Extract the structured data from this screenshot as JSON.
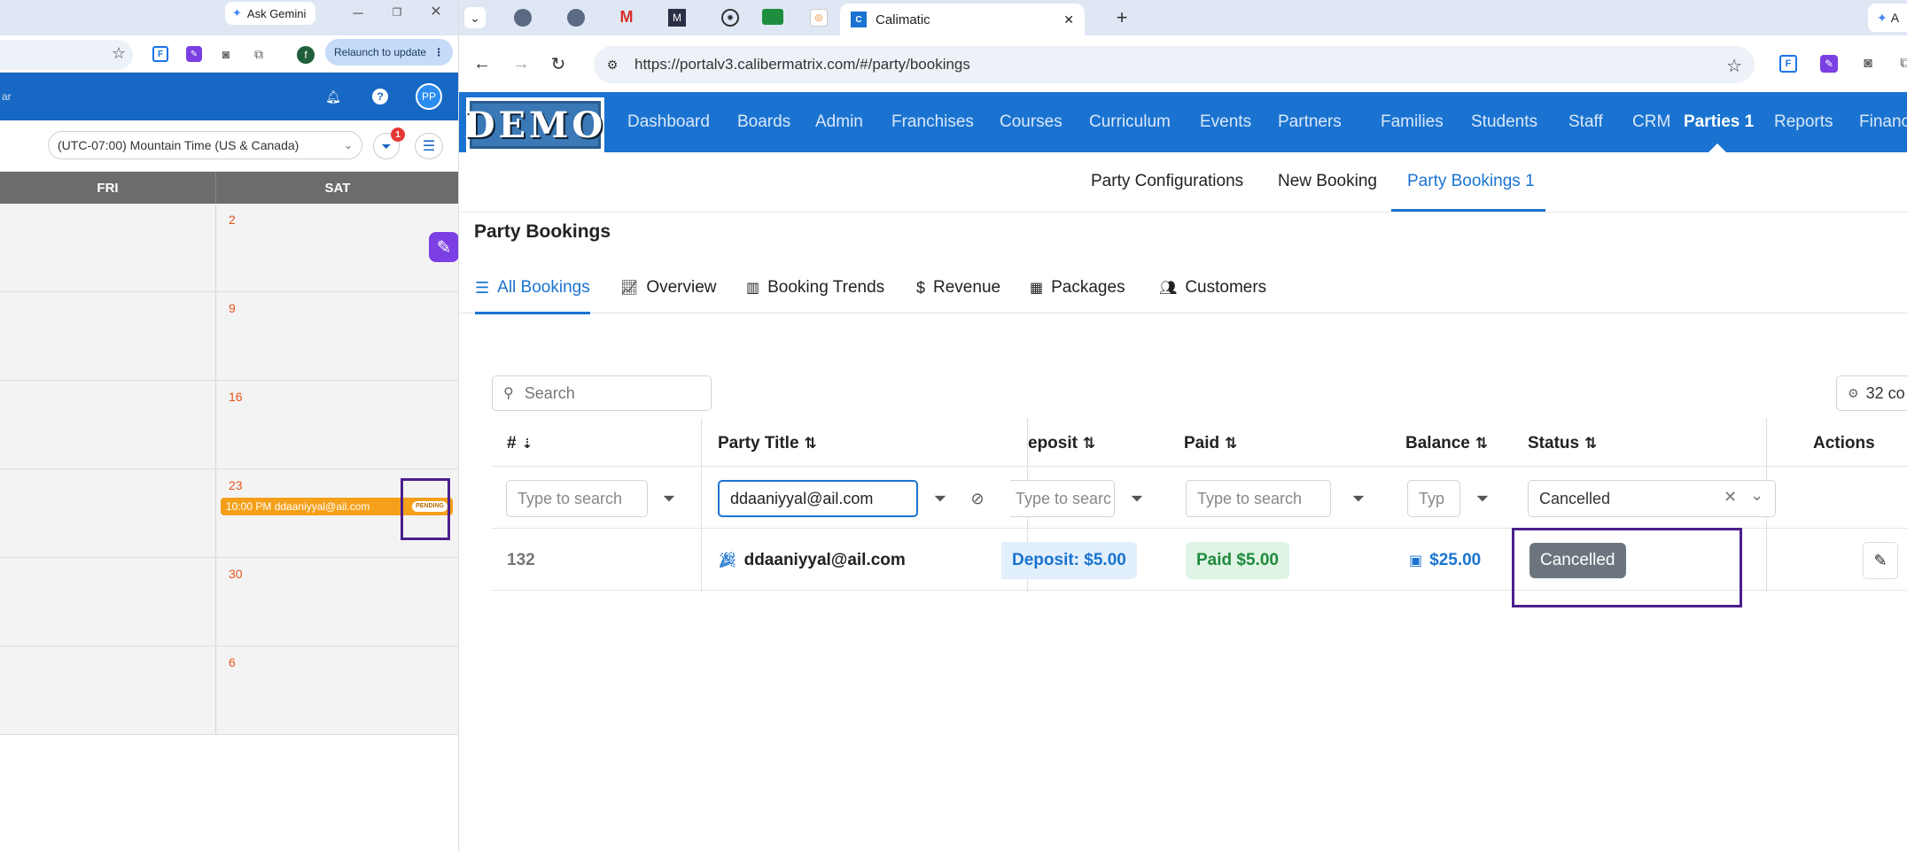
{
  "left_window": {
    "tab_title": "Ask Gemini",
    "relaunch_label": "Relaunch to update",
    "profile_letter": "f",
    "appbar_edge_text": "ar",
    "avatar_initials": "PP",
    "timezone": "(UTC-07:00) Mountain Time (US & Canada)",
    "filter_badge": "1",
    "calendar": {
      "columns": [
        "FRI",
        "SAT"
      ],
      "rows": [
        {
          "sat_day": "2"
        },
        {
          "sat_day": "9"
        },
        {
          "sat_day": "16"
        },
        {
          "sat_day": "23"
        },
        {
          "sat_day": "30"
        },
        {
          "sat_day": "6"
        }
      ],
      "event": {
        "time_label": "10:00 PM ddaaniyyal@ail.com",
        "status": "PENDING"
      }
    }
  },
  "browser": {
    "active_tab_title": "Calimatic",
    "right_edge_tab_text": "A",
    "url": "https://portalv3.calibermatrix.com/#/party/bookings"
  },
  "app": {
    "logo_text": "DEMO",
    "nav": [
      "Dashboard",
      "Boards",
      "Admin",
      "Franchises",
      "Courses",
      "Curriculum",
      "Events",
      "Partners",
      "Families",
      "Students",
      "Staff",
      "CRM",
      "Parties 1",
      "Reports",
      "Financ"
    ],
    "subnav": [
      "Party Configurations",
      "New Booking",
      "Party Bookings 1"
    ],
    "page_title": "Party Bookings",
    "tabs": [
      "All Bookings",
      "Overview",
      "Booking Trends",
      "Revenue",
      "Packages",
      "Customers"
    ],
    "search_placeholder": "Search",
    "columns_button": "32 co",
    "table": {
      "headers": [
        "#",
        "Party Title",
        "eposit",
        "Paid",
        "Balance",
        "Status",
        "Actions"
      ],
      "filters": {
        "id_placeholder": "Type to search",
        "title_value": "ddaaniyyal@ail.com",
        "deposit_placeholder": "Type to searc",
        "paid_placeholder": "Type to search",
        "balance_placeholder": "Typ",
        "status_value": "Cancelled"
      },
      "row": {
        "id": "132",
        "title": "ddaaniyyal@ail.com",
        "deposit": "Deposit: $5.00",
        "paid": "Paid $5.00",
        "balance": "$25.00",
        "status": "Cancelled"
      }
    }
  },
  "colors": {
    "nav_blue": "#1a73d1",
    "accent_blue": "#1a73d1",
    "event_orange": "#f5a01a",
    "highlight_purple": "#4b1f8c",
    "status_gray": "#6c757d",
    "paid_green": "#1f8a3d"
  }
}
